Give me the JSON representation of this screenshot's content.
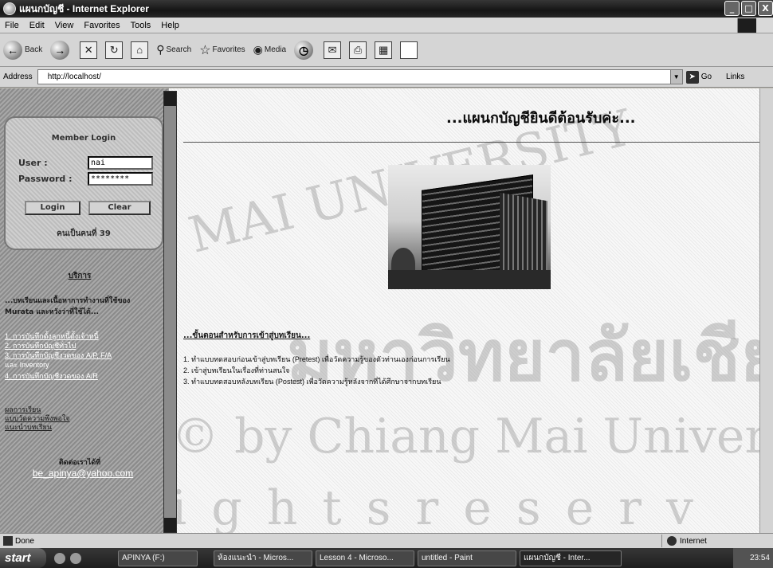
{
  "window": {
    "title": "แผนกบัญชี - Internet Explorer",
    "controls": [
      "_",
      "□",
      "X"
    ]
  },
  "menubar": {
    "items": [
      "File",
      "Edit",
      "View",
      "Favorites",
      "Tools",
      "Help"
    ]
  },
  "toolbar": {
    "back": "Back",
    "search": "Search",
    "favorites": "Favorites",
    "media": "Media"
  },
  "address": {
    "label": "Address",
    "url": "http://localhost/",
    "go": "Go",
    "links": "Links"
  },
  "sidebar": {
    "login_title": "Member Login",
    "user_label": "User :",
    "user_value": "nai",
    "password_label": "Password :",
    "password_value": "********",
    "login_button": "Login",
    "clear_button": "Clear",
    "visitor_count": "คนเป็นคนที่ 39",
    "menu_title": "บริการ",
    "menu_desc": "...บทเรียนและเนื้อหาการทำงานที่ใช้ของ Murata และหวังว่าที่ใช้ได้...",
    "links": [
      "1. การบันทึกตั้งลูกหนี้ตั้งเจ้าหนี้",
      "2. การบันทึกบัญชีทั่วไป",
      "3. การบันทึกบัญชีงวดของ A/P, F/A",
      "และ Inventory",
      "4. การบันทึกบัญชีงวดของ A/R"
    ],
    "extra_links": [
      "ผลการเรียน",
      "แบบวัดความพึงพอใจ",
      "แนะนำบทเรียน"
    ],
    "contact_title": "ติดต่อเราได้ที่",
    "contact_email": "be_apinya@yahoo.com"
  },
  "main": {
    "welcome": "...แผนกบัญชียินดีต้อนรับค่ะ...",
    "section_title": "...ขั้นตอนสำหรับการเข้าสู่บทเรียน...",
    "steps": [
      "1. ทำแบบทดสอบก่อนเข้าสู่บทเรียน (Pretest) เพื่อวัดความรู้ของตัวท่านเองก่อนการเรียน",
      "2. เข้าสู่บทเรียนในเรื่องที่ท่านสนใจ",
      "3. ทำแบบทดสอบหลังบทเรียน (Postest) เพื่อวัดความรู้หลังจากที่ได้ศึกษาจากบทเรียน"
    ]
  },
  "watermark": {
    "line1": "MAI UNIVERSITY",
    "line2": "มหาวิทยาลัยเชียงใหม่",
    "line3": "© by Chiang Mai University",
    "line4": "i g h t s   r e s e r v"
  },
  "status": {
    "text": "Done",
    "zone": "Internet"
  },
  "taskbar": {
    "start": "start",
    "tasks": [
      "APINYA (F:)",
      "ห้องแนะนำ - Micros...",
      "Lesson 4 - Microso...",
      "untitled - Paint",
      "แผนกบัญชี - Inter..."
    ],
    "clock": "23:54"
  }
}
